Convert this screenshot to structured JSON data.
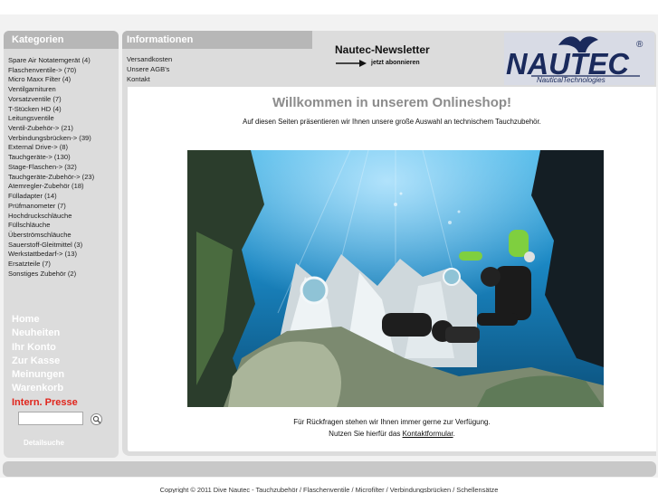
{
  "sidebar": {
    "title": "Kategorien",
    "categories": [
      "Spare Air Notatemgerät (4)",
      "Flaschenventile-> (70)",
      "Micro Maxx Filter (4)",
      "Ventilgarnituren",
      "Vorsatzventile (7)",
      "T-Stücken HD (4)",
      "Leitungsventile",
      "Ventil-Zubehör-> (21)",
      "Verbindungsbrücken-> (39)",
      "External Drive-> (8)",
      "Tauchgeräte-> (130)",
      "Stage-Flaschen-> (32)",
      "Tauchgeräte-Zubehör-> (23)",
      "Atemregler-Zubehör (18)",
      "Fülladapter (14)",
      "Prüfmanometer (7)",
      "Hochdruckschläuche",
      "Füllschläuche",
      "Überströmschläuche",
      "Sauerstoff-Gleitmittel (3)",
      "Werkstattbedarf-> (13)",
      "Ersatzteile (7)",
      "Sonstiges Zubehör (2)"
    ],
    "nav": [
      "Home",
      "Neuheiten",
      "Ihr Konto",
      "Zur Kasse",
      "Meinungen",
      "Warenkorb",
      "Intern. Presse"
    ],
    "search_value": "",
    "advanced_search": "Detailsuche"
  },
  "info": {
    "title": "Informationen",
    "links": [
      "Versandkosten",
      "Unsere AGB's",
      "Kontakt"
    ]
  },
  "newsletter": {
    "title": "Nautec-Newsletter",
    "link": "jetzt abonnieren"
  },
  "logo": {
    "text": "NAUTEC",
    "sub": "NauticalTechnologies",
    "registered": "®"
  },
  "main": {
    "welcome": "Willkommen in unserem Onlineshop!",
    "intro": "Auf diesen Seiten präsentieren wir Ihnen unsere große Auswahl an technischem Tauchzubehör.",
    "contact_line1": "Für Rückfragen stehen wir Ihnen immer gerne zur Verfügung.",
    "contact_line2_pre": "Nutzen Sie hierfür das ",
    "contact_link": "Kontaktformular",
    "contact_line2_post": "."
  },
  "footer": "Copyright © 2011 Dive Nautec - Tauchzubehör / Flaschenventile / Microfilter / Verbindungsbrücken / Schellensätze",
  "colors": {
    "panel": "#dcdcdc",
    "panel_head": "#b7b7b7",
    "welcome_gray": "#8c8c8c",
    "press_red": "#e0241b",
    "logo_navy": "#1a2a5c"
  }
}
